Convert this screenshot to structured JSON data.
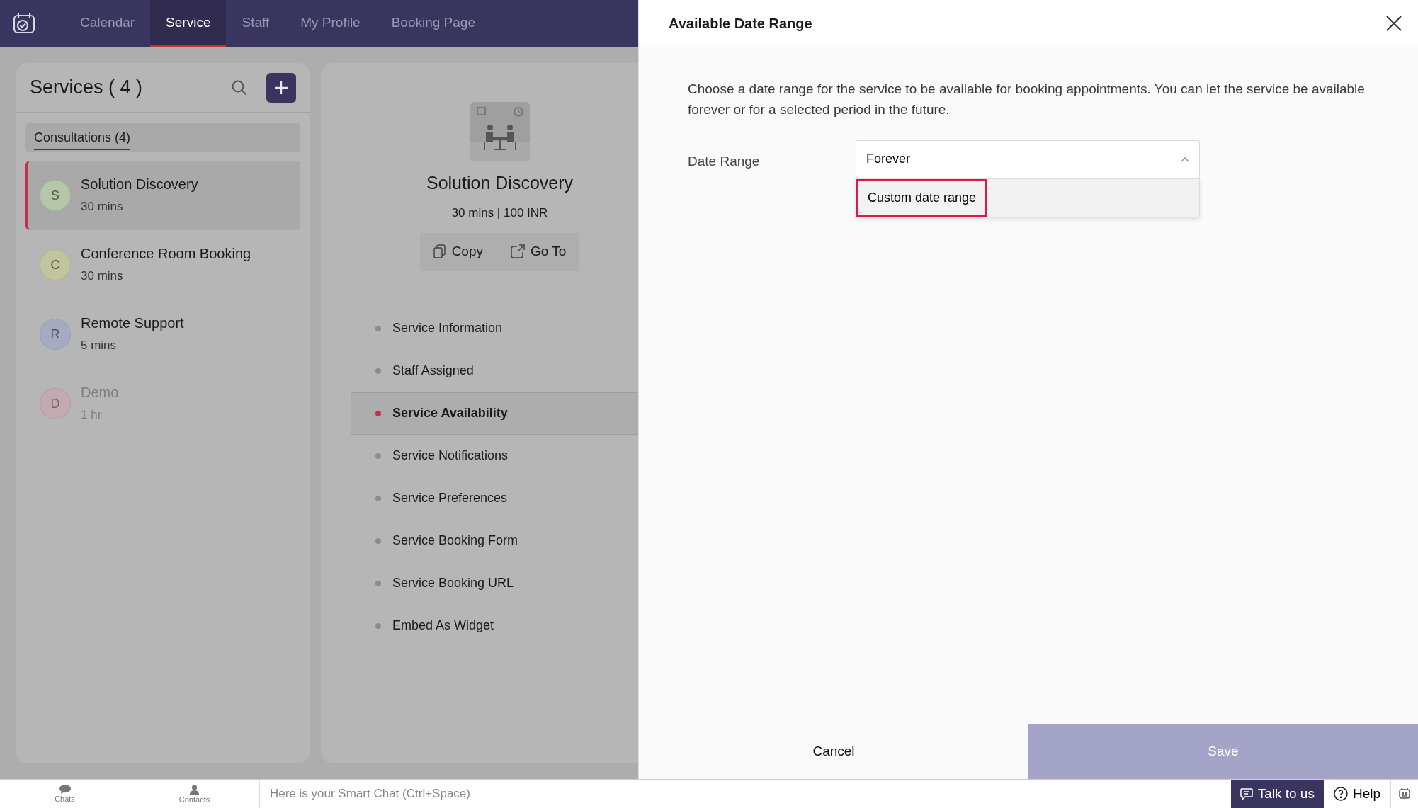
{
  "nav": {
    "tabs": [
      {
        "label": "Calendar",
        "selected": false
      },
      {
        "label": "Service",
        "selected": true
      },
      {
        "label": "Staff",
        "selected": false
      },
      {
        "label": "My Profile",
        "selected": false
      },
      {
        "label": "Booking Page",
        "selected": false
      }
    ]
  },
  "services": {
    "title": "Services ( 4 )",
    "category": "Consultations (4)",
    "items": [
      {
        "initial": "S",
        "name": "Solution Discovery",
        "duration": "30 mins",
        "selected": true,
        "disabled": false,
        "color": "#b4c7a6"
      },
      {
        "initial": "C",
        "name": "Conference Room Booking",
        "duration": "30 mins",
        "selected": false,
        "disabled": false,
        "color": "#c2c49c"
      },
      {
        "initial": "R",
        "name": "Remote Support",
        "duration": "5 mins",
        "selected": false,
        "disabled": false,
        "color": "#a6abc4"
      },
      {
        "initial": "D",
        "name": "Demo",
        "duration": "1 hr",
        "selected": false,
        "disabled": true,
        "color": "#c4a9b0"
      }
    ]
  },
  "detail": {
    "name": "Solution Discovery",
    "meta": "30 mins | 100 INR",
    "actions": [
      {
        "label": "Copy",
        "kind": "copy"
      },
      {
        "label": "Go To",
        "kind": "goto"
      }
    ],
    "menu": [
      {
        "label": "Service Information",
        "selected": false
      },
      {
        "label": "Staff Assigned",
        "selected": false
      },
      {
        "label": "Service Availability",
        "selected": true
      },
      {
        "label": "Service Notifications",
        "selected": false
      },
      {
        "label": "Service Preferences",
        "selected": false
      },
      {
        "label": "Service Booking Form",
        "selected": false
      },
      {
        "label": "Service Booking URL",
        "selected": false
      },
      {
        "label": "Embed As Widget",
        "selected": false
      }
    ]
  },
  "dialog": {
    "title": "Available Date Range",
    "description": "Choose a date range for the service to be available for booking appointments. You can let the service be available forever or for a selected period in the future.",
    "field_label": "Date Range",
    "value": "Forever",
    "expanded": true,
    "options": [
      {
        "label": "Custom date range",
        "highlighted": true
      }
    ],
    "buttons": [
      {
        "label": "Cancel",
        "kind": "secondary"
      },
      {
        "label": "Save",
        "kind": "primary"
      }
    ]
  },
  "bottom_bar": {
    "apps": [
      {
        "label": "Chats",
        "kind": "chat"
      },
      {
        "label": "Contacts",
        "kind": "contact"
      }
    ],
    "placeholder": "Here is your Smart Chat (Ctrl+Space)",
    "talk": "Talk to us",
    "help": "Help"
  }
}
